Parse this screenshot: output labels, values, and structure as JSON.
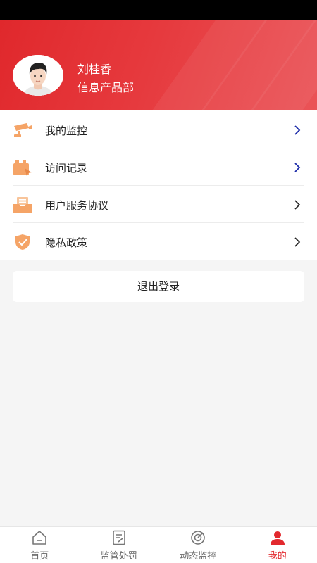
{
  "profile": {
    "name": "刘桂香",
    "department": "信息产品部"
  },
  "menu": {
    "items": [
      {
        "label": "我的监控",
        "icon": "camera-icon"
      },
      {
        "label": "访问记录",
        "icon": "visit-record-icon"
      },
      {
        "label": "用户服务协议",
        "icon": "mail-tray-icon"
      },
      {
        "label": "隐私政策",
        "icon": "shield-check-icon"
      }
    ]
  },
  "logout": {
    "label": "退出登录"
  },
  "tabbar": {
    "tabs": [
      {
        "label": "首页",
        "icon": "home-icon"
      },
      {
        "label": "监管处罚",
        "icon": "document-edit-icon"
      },
      {
        "label": "动态监控",
        "icon": "radar-target-icon"
      },
      {
        "label": "我的",
        "icon": "user-icon",
        "active": true
      }
    ]
  },
  "colors": {
    "brand_red": "#e2292e",
    "icon_orange": "#f5a467",
    "chevron_blue": "#1a2aa8"
  }
}
